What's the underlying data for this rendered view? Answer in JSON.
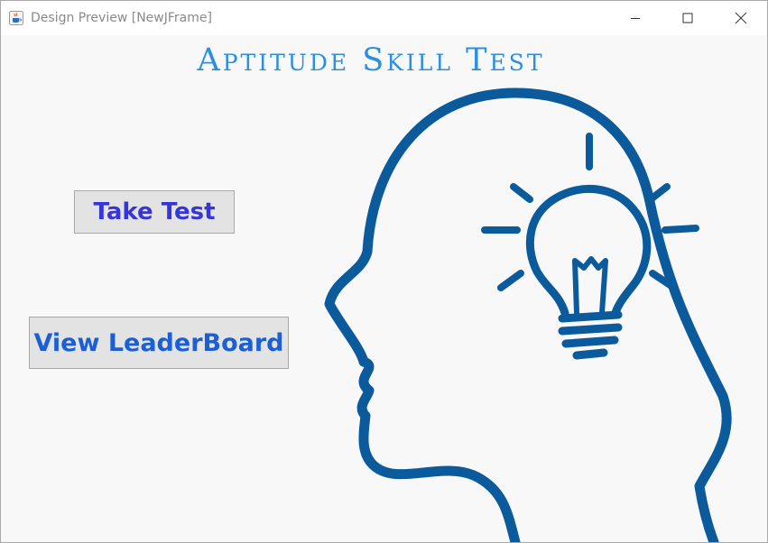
{
  "window": {
    "title": "Design Preview [NewJFrame]",
    "app_icon": "java-cup-icon",
    "controls": {
      "minimize": "minimize-icon",
      "maximize": "maximize-icon",
      "close": "close-icon"
    }
  },
  "main": {
    "heading": "Aptitude Skill Test",
    "take_test_label": "Take Test",
    "leaderboard_label": "View LeaderBoard",
    "illustration": "head-lightbulb-icon"
  },
  "colors": {
    "heading": "#2b8fe0",
    "take_test_text": "#3636d8",
    "leaderboard_text": "#1a5fd6",
    "button_bg": "#e3e3e4",
    "illustration": "#0b5a9c",
    "background": "#f8f8f9"
  }
}
